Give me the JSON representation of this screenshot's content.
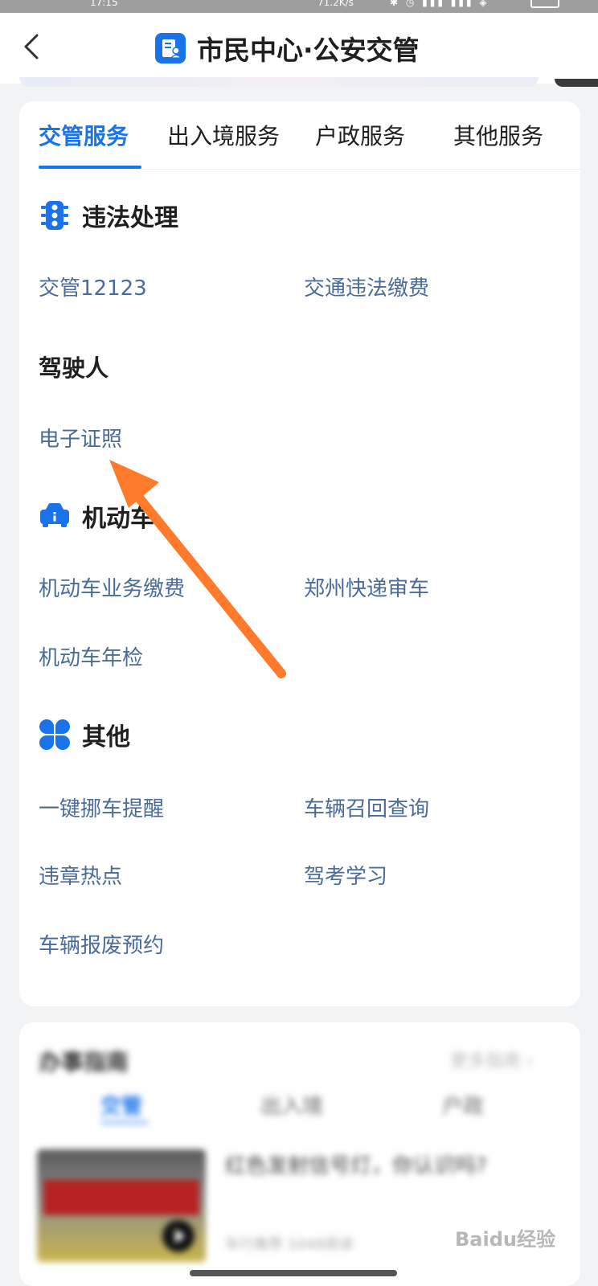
{
  "status_bar": {
    "time": "17:15",
    "speed": "71.2K/s"
  },
  "header": {
    "title": "市民中心·公安交管",
    "back_icon": "chevron-left-icon",
    "title_icon": "document-person-icon"
  },
  "tabs": [
    {
      "label": "交管服务",
      "active": true
    },
    {
      "label": "出入境服务",
      "active": false
    },
    {
      "label": "户政服务",
      "active": false
    },
    {
      "label": "其他服务",
      "active": false
    }
  ],
  "sections": {
    "violation": {
      "title": "违法处理",
      "icon": "traffic-light-icon",
      "items": [
        "交管12123",
        "交通违法缴费"
      ]
    },
    "driver": {
      "title": "驾驶人",
      "items": [
        "电子证照"
      ]
    },
    "vehicle": {
      "title": "机动车",
      "icon": "car-icon",
      "items": [
        "机动车业务缴费",
        "郑州快递审车",
        "机动车年检"
      ]
    },
    "other": {
      "title": "其他",
      "icon": "four-petal-icon",
      "items": [
        "一键挪车提醒",
        "车辆召回查询",
        "违章热点",
        "驾考学习",
        "车辆报废预约"
      ]
    }
  },
  "guide": {
    "title": "办事指南",
    "more": "更多指南 ›",
    "tabs": [
      "交管",
      "出入境",
      "户政"
    ],
    "article_title": "红色发射信号灯，你认识吗?",
    "article_meta": "车行推荐 1048阅读"
  },
  "watermark": "Baidu经验",
  "colors": {
    "accent": "#1a73e8",
    "link": "#4a6b9a",
    "arrow": "#ff7a2a"
  }
}
